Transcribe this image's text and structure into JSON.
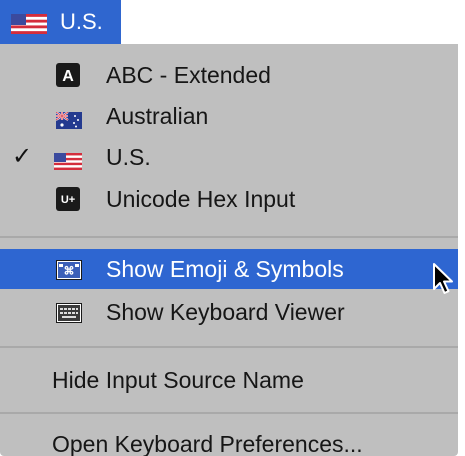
{
  "menubar": {
    "label": "U.S.",
    "flag_icon": "us-flag-icon",
    "accent_color": "#2f66cf"
  },
  "menu": {
    "input_sources": [
      {
        "label": "ABC - Extended",
        "icon": "abc-extended-icon",
        "checked": false
      },
      {
        "label": "Australian",
        "icon": "australia-flag-icon",
        "checked": false
      },
      {
        "label": "U.S.",
        "icon": "us-flag-icon",
        "checked": true
      },
      {
        "label": "Unicode Hex Input",
        "icon": "unicode-hex-icon",
        "checked": false
      }
    ],
    "checkmark": "✓",
    "viewer_items": [
      {
        "label": "Show Emoji & Symbols",
        "icon": "emoji-symbols-icon",
        "highlighted": true
      },
      {
        "label": "Show Keyboard Viewer",
        "icon": "keyboard-viewer-icon",
        "highlighted": false
      }
    ],
    "hide_input_source_name": "Hide Input Source Name",
    "open_keyboard_preferences": "Open Keyboard Preferences...",
    "background_color": "#bfbfbf",
    "highlight_color": "#2e66d1"
  }
}
